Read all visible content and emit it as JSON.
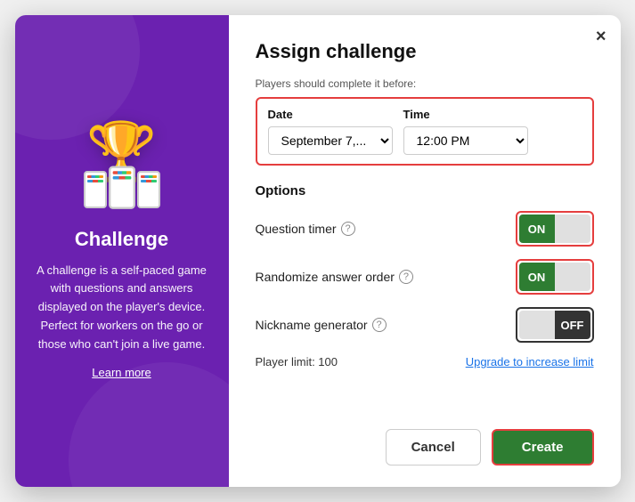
{
  "modal": {
    "title": "Assign challenge",
    "close_label": "×"
  },
  "left": {
    "title": "Challenge",
    "description": "A challenge is a self-paced game with questions and answers displayed on the player's device. Perfect for workers on the go or those who can't join a live game.",
    "learn_more": "Learn more",
    "trophy_emoji": "🏆"
  },
  "date_section": {
    "label": "Players should complete it before:",
    "date_col_label": "Date",
    "time_col_label": "Time",
    "date_value": "September 7,...",
    "time_value": "12:00 PM"
  },
  "options": {
    "title": "Options",
    "rows": [
      {
        "label": "Question timer",
        "state": "ON"
      },
      {
        "label": "Randomize answer order",
        "state": "ON"
      },
      {
        "label": "Nickname generator",
        "state": "OFF"
      }
    ]
  },
  "player_limit": {
    "text": "Player limit: 100",
    "upgrade_link": "Upgrade to increase limit"
  },
  "footer": {
    "cancel_label": "Cancel",
    "create_label": "Create"
  }
}
